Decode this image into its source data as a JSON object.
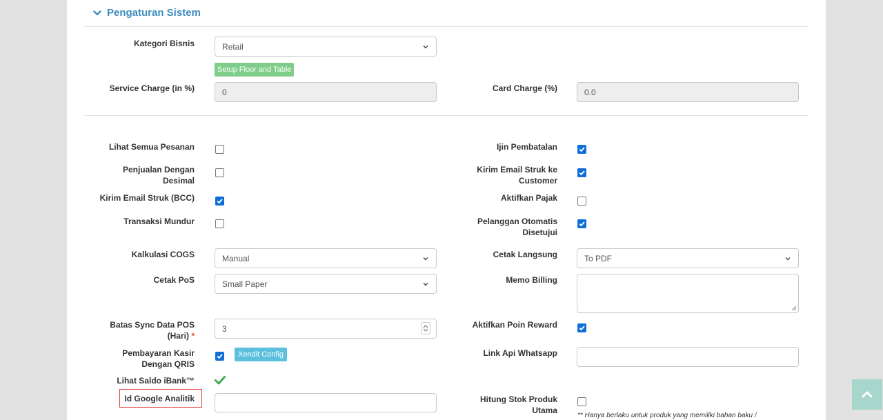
{
  "section": {
    "title": "Pengaturan Sistem"
  },
  "fields": {
    "kategori_bisnis": {
      "label": "Kategori Bisnis",
      "value": "Retail"
    },
    "setup_floor_button": "Setup Floor and Table",
    "service_charge": {
      "label": "Service Charge (in %)",
      "value": "0"
    },
    "card_charge": {
      "label": "Card Charge (%)",
      "value": "0.0"
    },
    "lihat_semua_pesanan": {
      "label": "Lihat Semua Pesanan",
      "checked": false
    },
    "ijin_pembatalan": {
      "label": "Ijin Pembatalan",
      "checked": true
    },
    "penjualan_desimal": {
      "label_line1": "Penjualan Dengan",
      "label_line2": "Desimal",
      "checked": false
    },
    "kirim_email_customer": {
      "label_line1": "Kirim Email Struk ke",
      "label_line2": "Customer",
      "checked": true
    },
    "kirim_email_bcc": {
      "label": "Kirim Email Struk (BCC)",
      "checked": true
    },
    "aktifkan_pajak": {
      "label": "Aktifkan Pajak",
      "checked": false
    },
    "transaksi_mundur": {
      "label": "Transaksi Mundur",
      "checked": false
    },
    "pelanggan_otomatis": {
      "label_line1": "Pelanggan Otomatis",
      "label_line2": "Disetujui",
      "checked": true
    },
    "kalkulasi_cogs": {
      "label": "Kalkulasi COGS",
      "value": "Manual"
    },
    "cetak_langsung": {
      "label": "Cetak Langsung",
      "value": "To PDF"
    },
    "cetak_pos": {
      "label": "Cetak PoS",
      "value": "Small Paper"
    },
    "memo_billing": {
      "label": "Memo Billing",
      "value": ""
    },
    "batas_sync": {
      "label_line1": "Batas Sync Data POS",
      "label_line2": "(Hari)",
      "required": "*",
      "value": "3"
    },
    "aktifkan_poin_reward": {
      "label": "Aktifkan Poin Reward",
      "checked": true
    },
    "pembayaran_qris": {
      "label_line1": "Pembayaran Kasir",
      "label_line2": "Dengan QRIS",
      "checked": true,
      "button": "Xendit Config"
    },
    "link_api_whatsapp": {
      "label": "Link Api Whatsapp",
      "value": ""
    },
    "lihat_saldo_ibank": {
      "label": "Lihat Saldo iBank™",
      "icon": "check-icon"
    },
    "id_google_analitik": {
      "label": "Id Google Analitik",
      "value": ""
    },
    "hitung_stok_produk": {
      "label_line1": "Hitung Stok Produk",
      "label_line2": "Utama",
      "checked": false,
      "note": "** Hanya berlaku untuk produk yang memiliki bahan baku /"
    }
  },
  "colors": {
    "accent": "#3c8dbc",
    "checkbox": "#0f6fd9",
    "green_button": "#7fcd8a",
    "blue_button": "#5bc0de",
    "check_icon": "#46a84f",
    "highlight": "#e03a3a"
  }
}
